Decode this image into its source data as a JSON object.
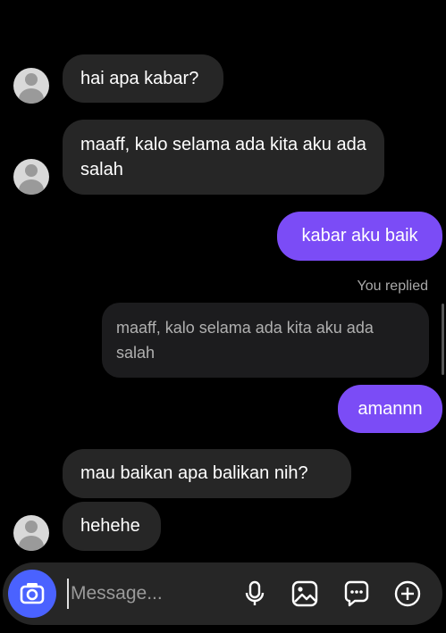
{
  "messages": [
    {
      "side": "incoming",
      "text": "hai apa kabar?"
    },
    {
      "side": "incoming",
      "text": "maaff, kalo selama ada kita aku ada salah"
    },
    {
      "side": "outgoing",
      "text": "kabar aku baik"
    },
    {
      "side": "outgoing",
      "text": "amannn"
    },
    {
      "side": "incoming",
      "text": "mau baikan apa balikan nih?"
    },
    {
      "side": "incoming",
      "text": "hehehe"
    }
  ],
  "reply": {
    "label": "You replied",
    "quoted_text": "maaff, kalo selama ada kita aku ada salah"
  },
  "composer": {
    "placeholder": "Message..."
  },
  "icons": {
    "camera": "camera-icon",
    "mic": "microphone-icon",
    "gallery": "image-gallery-icon",
    "sticker": "sticker-icon",
    "more": "add-plus-icon"
  },
  "colors": {
    "background": "#000000",
    "incoming_bubble": "#262626",
    "outgoing_bubble": "#7b4cf6",
    "camera_button": "#4a62ff"
  }
}
